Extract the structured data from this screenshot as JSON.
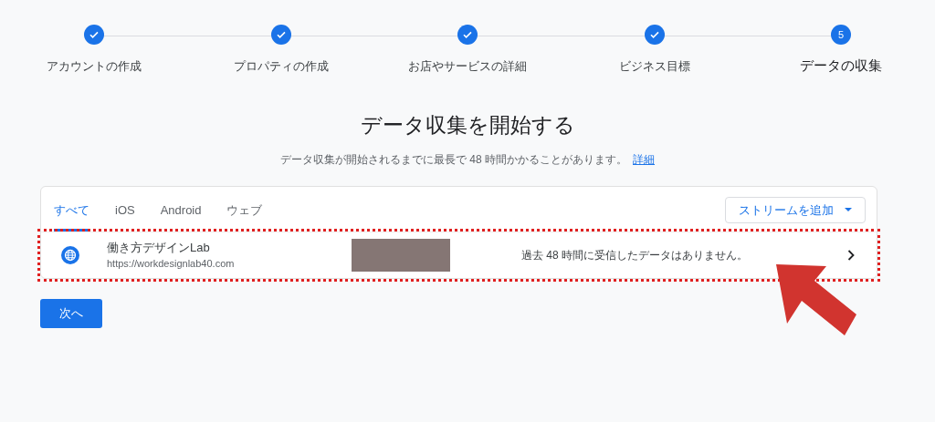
{
  "steps": [
    {
      "label": "アカウントの作成",
      "completed": true
    },
    {
      "label": "プロパティの作成",
      "completed": true
    },
    {
      "label": "お店やサービスの詳細",
      "completed": true
    },
    {
      "label": "ビジネス目標",
      "completed": true
    },
    {
      "label": "データの収集",
      "completed": false,
      "number": "5"
    }
  ],
  "heading": "データ収集を開始する",
  "subtitle": "データ収集が開始されるまでに最長で 48 時間かかることがあります。",
  "subtitle_link": "詳細",
  "tabs": [
    {
      "label": "すべて",
      "selected": true
    },
    {
      "label": "iOS",
      "selected": false
    },
    {
      "label": "Android",
      "selected": false
    },
    {
      "label": "ウェブ",
      "selected": false
    }
  ],
  "add_stream_button": "ストリームを追加",
  "streams": [
    {
      "name": "働き方デザインLab",
      "url": "https://workdesignlab40.com",
      "status": "過去 48 時間に受信したデータはありません。",
      "highlighted": true
    }
  ],
  "next_button": "次へ"
}
